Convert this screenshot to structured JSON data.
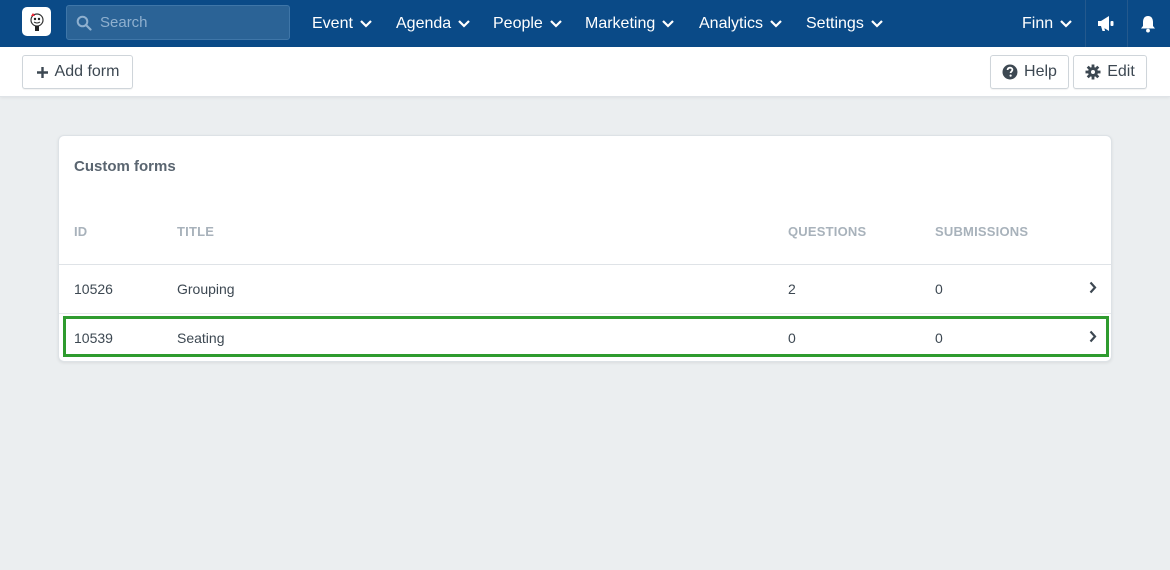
{
  "nav": {
    "search_placeholder": "Search",
    "menus": [
      {
        "label": "Event"
      },
      {
        "label": "Agenda"
      },
      {
        "label": "People"
      },
      {
        "label": "Marketing"
      },
      {
        "label": "Analytics"
      },
      {
        "label": "Settings"
      }
    ],
    "user": {
      "label": "Finn"
    },
    "icons": [
      "logo-icon",
      "search-icon",
      "chevron-down-icon",
      "megaphone-icon",
      "bell-icon"
    ]
  },
  "actionbar": {
    "add_label": "Add form",
    "help_label": "Help",
    "edit_label": "Edit"
  },
  "card": {
    "title": "Custom forms",
    "columns": [
      "ID",
      "TITLE",
      "QUESTIONS",
      "SUBMISSIONS"
    ],
    "rows": [
      {
        "id": "10526",
        "title": "Grouping",
        "questions": "2",
        "submissions": "0",
        "selected": false
      },
      {
        "id": "10539",
        "title": "Seating",
        "questions": "0",
        "submissions": "0",
        "selected": true
      }
    ]
  },
  "colors": {
    "nav_bg": "#0a4a87",
    "page_bg": "#ebeef0",
    "selection_outline": "#2f9b2f"
  }
}
